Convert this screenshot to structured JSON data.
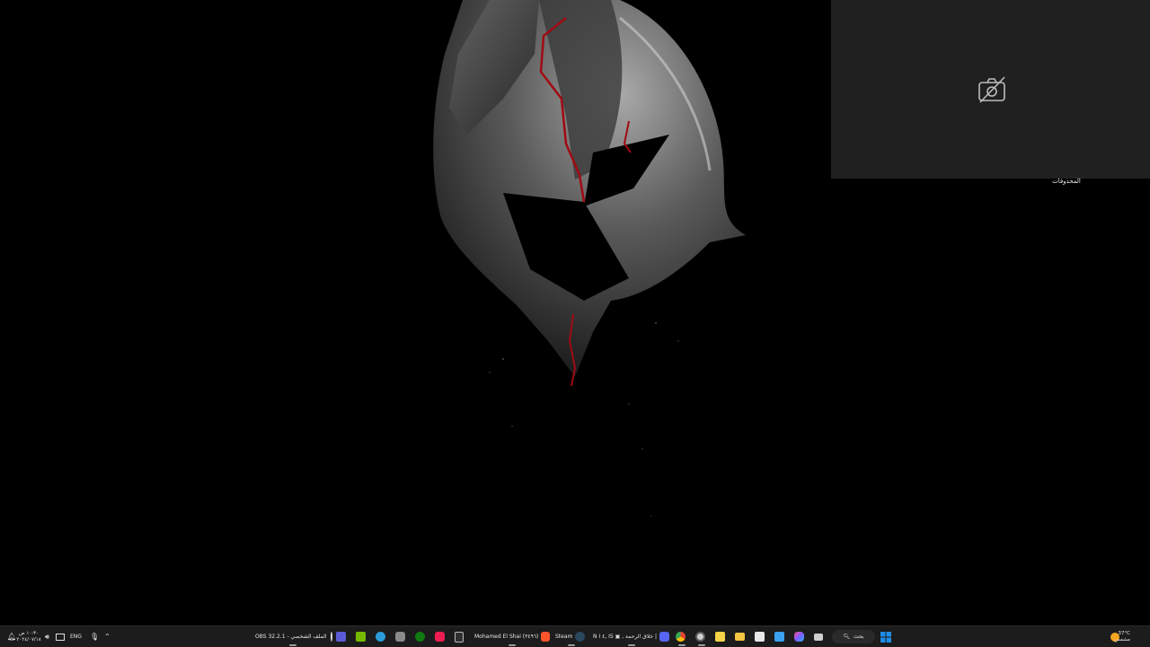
{
  "desktop": {
    "recycle_bin_label": "المحذوفات"
  },
  "camera_overlay": {
    "icon": "camera-off-icon"
  },
  "taskbar": {
    "clock": {
      "time": "١٠:٣٠ ص",
      "date": "٢٠٢٤/٠٧/١٨"
    },
    "tray": {
      "language": "ENG",
      "icons": [
        "notification-icon",
        "volume-icon",
        "network-icon",
        "microphone-icon",
        "chevron-up-icon"
      ]
    },
    "apps": [
      {
        "name": "obs-icon",
        "label": "OBS 32.2.1 - الملف الشخصي"
      },
      {
        "name": "monitor-app-icon"
      },
      {
        "name": "nvidia-icon"
      },
      {
        "name": "photo-app-icon"
      },
      {
        "name": "edge-dev-icon"
      },
      {
        "name": "xbox-icon"
      },
      {
        "name": "tiktok-icon"
      },
      {
        "name": "epic-games-icon"
      },
      {
        "name": "brave-icon",
        "label": "Mohamed El Shai (٣٤٩٦)"
      },
      {
        "name": "steam-icon",
        "label": "Steam"
      },
      {
        "name": "discord-icon",
        "label": "N I ٤, IS ▣ , خلاق الرحمة |"
      },
      {
        "name": "chrome-icon"
      },
      {
        "name": "chrome-alt-icon"
      },
      {
        "name": "sticky-notes-icon"
      },
      {
        "name": "file-explorer-icon"
      },
      {
        "name": "calendar-icon"
      },
      {
        "name": "notepad-icon"
      },
      {
        "name": "copilot-icon"
      },
      {
        "name": "task-view-icon"
      }
    ],
    "search_label": "بحث",
    "weather": {
      "temp": "37°C",
      "condition": "مشمس"
    },
    "colors": {
      "accent_windows": "#1f8ce6",
      "taskbar_bg": "#1c1c1c"
    }
  }
}
